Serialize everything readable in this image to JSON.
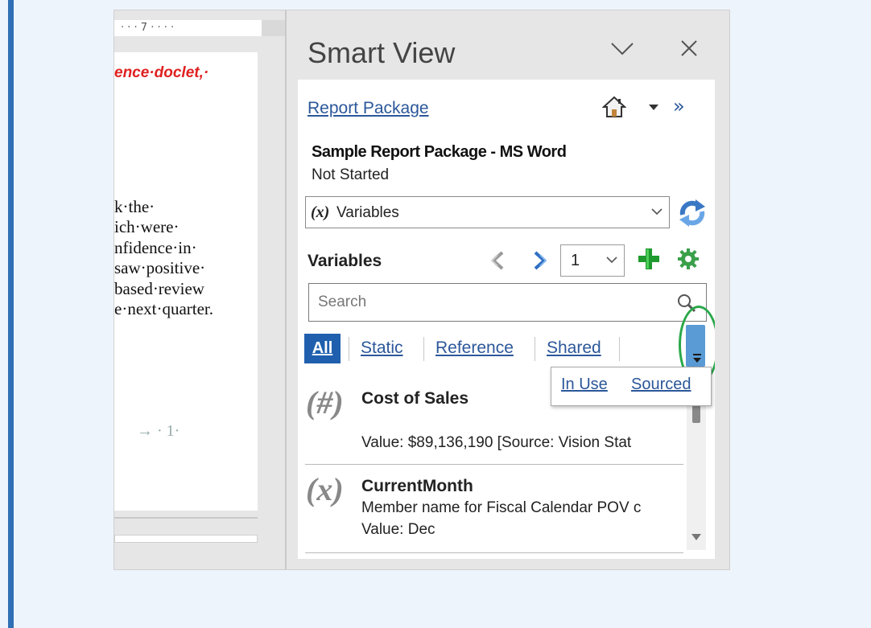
{
  "document": {
    "ruler_text": "· · · 7 · · · ·",
    "red_heading": "ence·doclet,·",
    "lines": [
      "k·the·",
      "ich·were·",
      "nfidence·in·",
      "saw·positive·",
      "based·review",
      "e·next·quarter."
    ],
    "footer": "→   ·  1·"
  },
  "pane": {
    "title": "Smart View",
    "report_package_link": "Report Package",
    "package_name": "Sample Report Package - MS Word",
    "package_status": "Not Started",
    "variables_dropdown": {
      "glyph": "(x)",
      "selected": "Variables"
    },
    "variables_heading": "Variables",
    "page_number": "1",
    "search_placeholder": "Search",
    "filters": {
      "all": "All",
      "static": "Static",
      "reference": "Reference",
      "shared": "Shared"
    },
    "overflow_menu": {
      "in_use": "In Use",
      "sourced": "Sourced"
    },
    "items": [
      {
        "glyph": "(#)",
        "name": "Cost of Sales",
        "lines": [
          "Value:  $89,136,190  [Source: Vision Stat"
        ]
      },
      {
        "glyph": "(x)",
        "name": "CurrentMonth",
        "lines": [
          "Member name for Fiscal Calendar POV c",
          "Value: Dec"
        ]
      }
    ]
  },
  "colors": {
    "accent_blue": "#2b579a",
    "all_button": "#1f5fae",
    "heading_red": "#e02020",
    "highlight_green": "#2aa84a",
    "page_frame_bar": "#2f6fb6"
  }
}
